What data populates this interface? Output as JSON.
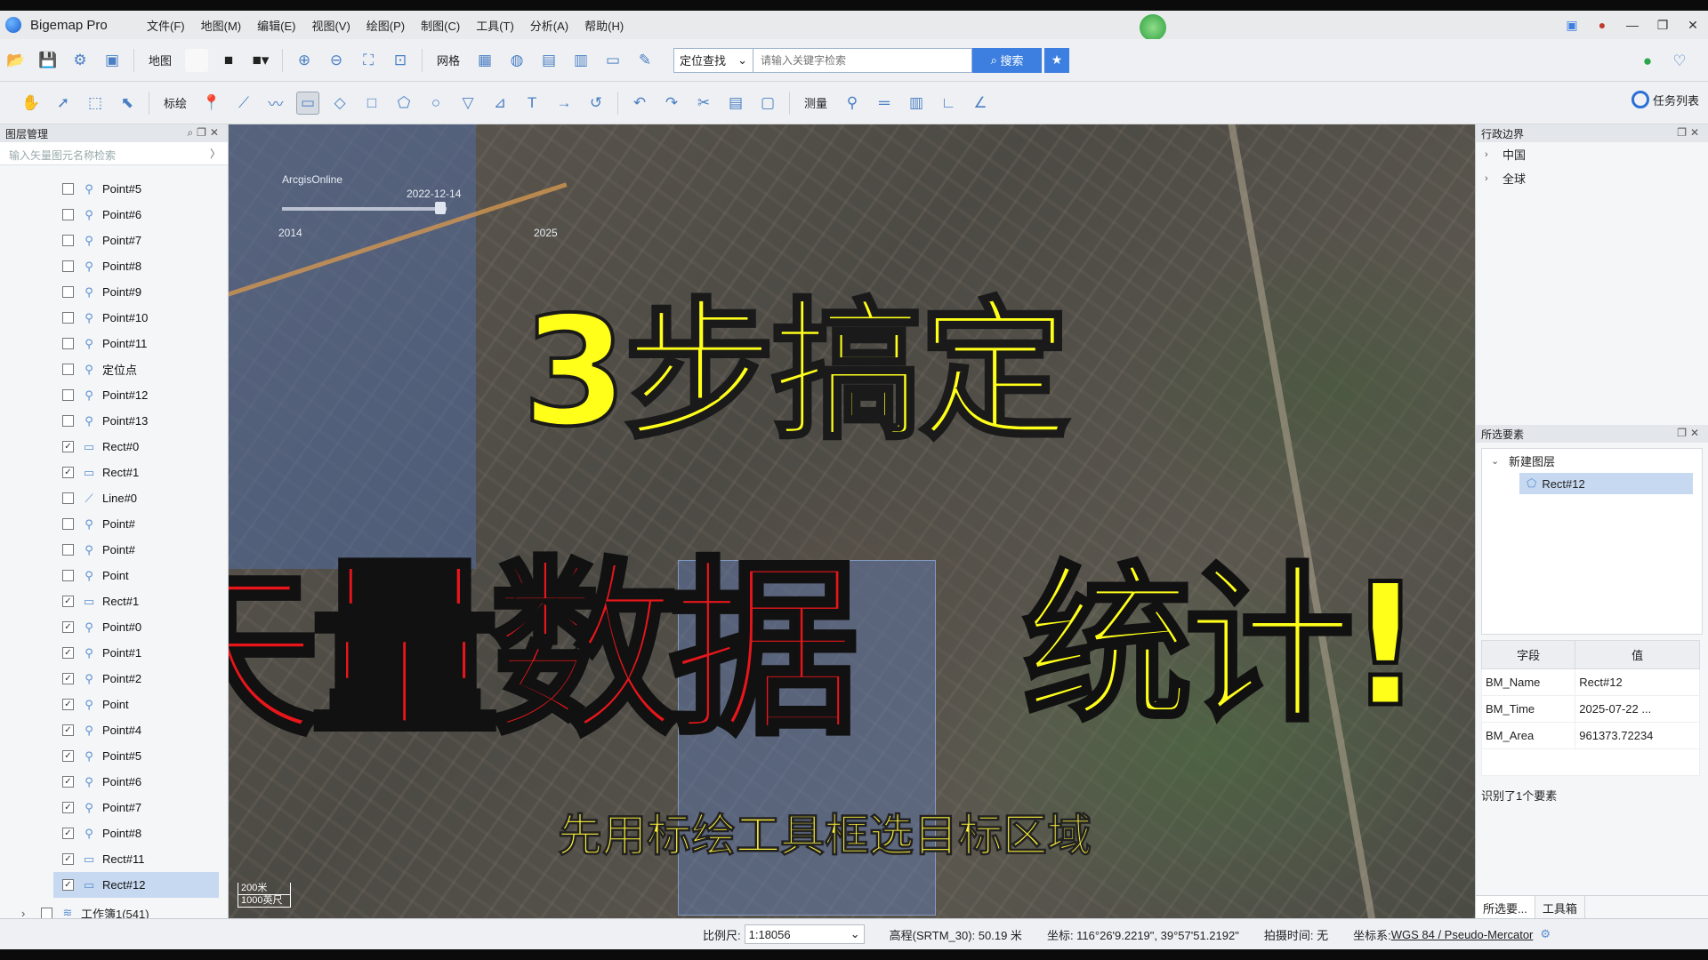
{
  "app": {
    "title": "Bigemap Pro",
    "menus": [
      "文件(F)",
      "地图(M)",
      "编辑(E)",
      "视图(V)",
      "绘图(P)",
      "制图(C)",
      "工具(T)",
      "分析(A)",
      "帮助(H)"
    ]
  },
  "toolbar1": {
    "map_label": "地图",
    "grid_label": "网格",
    "location_select": "定位查找",
    "search_placeholder": "请输入关键字检索",
    "search_button": "搜索"
  },
  "toolbar2": {
    "draw_label": "标绘",
    "measure_label": "测量",
    "tasklist_label": "任务列表"
  },
  "layer_panel": {
    "title": "图层管理",
    "search_placeholder": "输入矢量图元名称检索",
    "layers": [
      {
        "name": "Point#5",
        "checked": false,
        "icon": "point"
      },
      {
        "name": "Point#6",
        "checked": false,
        "icon": "point"
      },
      {
        "name": "Point#7",
        "checked": false,
        "icon": "point"
      },
      {
        "name": "Point#8",
        "checked": false,
        "icon": "point"
      },
      {
        "name": "Point#9",
        "checked": false,
        "icon": "point"
      },
      {
        "name": "Point#10",
        "checked": false,
        "icon": "point"
      },
      {
        "name": "Point#11",
        "checked": false,
        "icon": "point"
      },
      {
        "name": "定位点",
        "checked": false,
        "icon": "point"
      },
      {
        "name": "Point#12",
        "checked": false,
        "icon": "point"
      },
      {
        "name": "Point#13",
        "checked": false,
        "icon": "point"
      },
      {
        "name": "Rect#0",
        "checked": true,
        "icon": "rect"
      },
      {
        "name": "Rect#1",
        "checked": true,
        "icon": "rect"
      },
      {
        "name": "Line#0",
        "checked": false,
        "icon": "line"
      },
      {
        "name": "Point#",
        "checked": false,
        "icon": "point"
      },
      {
        "name": "Point#",
        "checked": false,
        "icon": "point"
      },
      {
        "name": "Point",
        "checked": false,
        "icon": "point"
      },
      {
        "name": "Rect#1",
        "checked": true,
        "icon": "rect"
      },
      {
        "name": "Point#0",
        "checked": true,
        "icon": "point"
      },
      {
        "name": "Point#1",
        "checked": true,
        "icon": "point"
      },
      {
        "name": "Point#2",
        "checked": true,
        "icon": "point"
      },
      {
        "name": "Point",
        "checked": true,
        "icon": "point"
      },
      {
        "name": "Point#4",
        "checked": true,
        "icon": "point"
      },
      {
        "name": "Point#5",
        "checked": true,
        "icon": "point"
      },
      {
        "name": "Point#6",
        "checked": true,
        "icon": "point"
      },
      {
        "name": "Point#7",
        "checked": true,
        "icon": "point"
      },
      {
        "name": "Point#8",
        "checked": true,
        "icon": "point"
      },
      {
        "name": "Rect#11",
        "checked": true,
        "icon": "rect"
      },
      {
        "name": "Rect#12",
        "checked": true,
        "icon": "rect",
        "selected": true
      }
    ],
    "workbook": "工作簿1(541)"
  },
  "map": {
    "source": "ArcgisOnline",
    "date": "2022-12-14",
    "year_start": "2014",
    "year_end": "2025",
    "scale_m": "200米",
    "scale_ft": "1000英尺"
  },
  "overlay": {
    "line1": "3步搞定",
    "line2": "矢量数据",
    "line3": "统计!",
    "subtitle": "先用标绘工具框选目标区域"
  },
  "admin_panel": {
    "title": "行政边界",
    "items": [
      "中国",
      "全球"
    ]
  },
  "selected_panel": {
    "title": "所选要素",
    "group": "新建图层",
    "child": "Rect#12",
    "headers": [
      "字段",
      "值"
    ],
    "rows": [
      {
        "field": "BM_Name",
        "value": "Rect#12"
      },
      {
        "field": "BM_Time",
        "value": "2025-07-22 ..."
      },
      {
        "field": "BM_Area",
        "value": "961373.72234"
      }
    ],
    "count_text": "识别了1个要素",
    "tabs": [
      "所选要...",
      "工具箱"
    ]
  },
  "statusbar": {
    "scale_label": "比例尺:",
    "scale_value": "1:18056",
    "elevation": "高程(SRTM_30): 50.19 米",
    "coords": "坐标: 116°26'9.2219\", 39°57'51.2192\"",
    "capture_time": "拍摄时间: 无",
    "crs_label": "坐标系:",
    "crs_value": "WGS 84 / Pseudo-Mercator"
  }
}
